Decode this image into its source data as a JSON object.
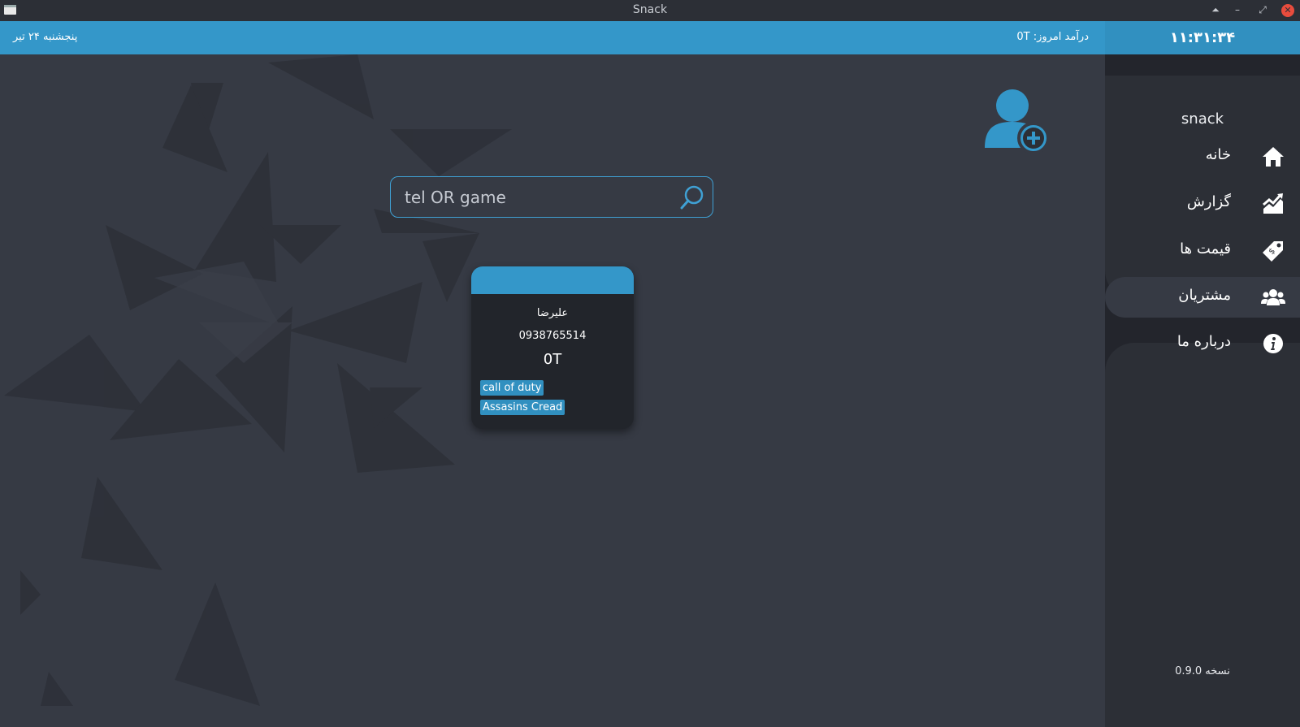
{
  "window": {
    "title": "Snack"
  },
  "topbar": {
    "date": "پنجشنبه ۲۴ تیر",
    "income_label": "درآمد امروز: ",
    "income_value": "0T"
  },
  "sidebar": {
    "clock": "۱۱:۳۱:۳۴",
    "brand": "snack",
    "items": [
      {
        "label": "خانه",
        "icon": "home-icon"
      },
      {
        "label": "گزارش",
        "icon": "chart-icon"
      },
      {
        "label": "قیمت ها",
        "icon": "price-tag-icon"
      },
      {
        "label": "مشتریان",
        "icon": "users-icon",
        "active": true
      },
      {
        "label": "درباره ما",
        "icon": "info-icon"
      }
    ],
    "version": "نسخه 0.9.0"
  },
  "search": {
    "value": "tel OR game",
    "placeholder": "tel OR game"
  },
  "customers": [
    {
      "name": "علیرضا",
      "phone": "0938765514",
      "balance": "0T",
      "games": [
        "call of duty",
        "Assasins Cread"
      ]
    }
  ],
  "colors": {
    "accent": "#3497c9",
    "background": "#363a44",
    "sidebar": "#2c2f36",
    "card": "#22252b"
  }
}
